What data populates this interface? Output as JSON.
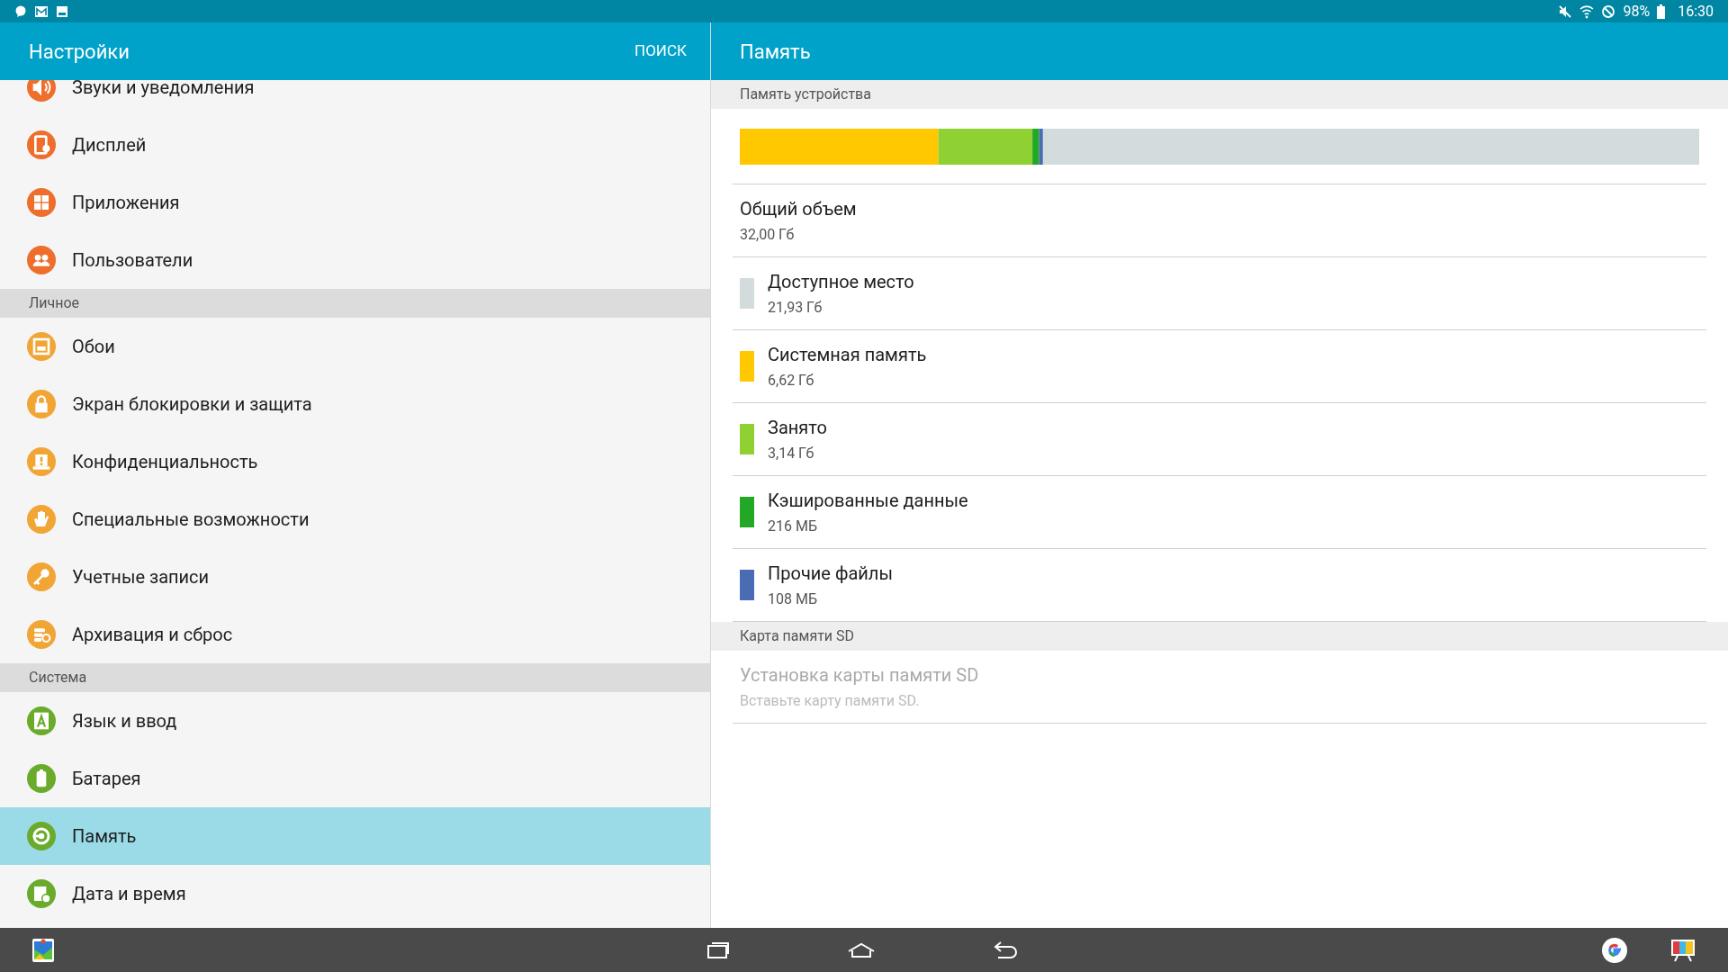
{
  "status_bar": {
    "battery": "98%",
    "time": "16:30"
  },
  "settings_panel": {
    "title": "Настройки",
    "search_button": "ПОИСК",
    "groups": [
      {
        "items": [
          {
            "label": "Звуки и уведомления",
            "color": "#ee6e2c",
            "selected": false
          },
          {
            "label": "Дисплей",
            "color": "#ee6e2c",
            "selected": false
          },
          {
            "label": "Приложения",
            "color": "#ee6e2c",
            "selected": false
          },
          {
            "label": "Пользователи",
            "color": "#ee6e2c",
            "selected": false
          }
        ]
      },
      {
        "header": "Личное",
        "items": [
          {
            "label": "Обои",
            "color": "#f0a535",
            "selected": false
          },
          {
            "label": "Экран блокировки и защита",
            "color": "#f0a535",
            "selected": false
          },
          {
            "label": "Конфиденциальность",
            "color": "#f0a535",
            "selected": false
          },
          {
            "label": "Специальные возможности",
            "color": "#f0a535",
            "selected": false
          },
          {
            "label": "Учетные записи",
            "color": "#f0a535",
            "selected": false
          },
          {
            "label": "Архивация и сброс",
            "color": "#f0a535",
            "selected": false
          }
        ]
      },
      {
        "header": "Система",
        "items": [
          {
            "label": "Язык и ввод",
            "color": "#6aab2b",
            "selected": false
          },
          {
            "label": "Батарея",
            "color": "#6aab2b",
            "selected": false
          },
          {
            "label": "Память",
            "color": "#6aab2b",
            "selected": true
          },
          {
            "label": "Дата и время",
            "color": "#6aab2b",
            "selected": false
          }
        ]
      }
    ]
  },
  "detail_panel": {
    "title": "Память",
    "device_memory": {
      "header": "Память устройства",
      "total": {
        "label": "Общий объем",
        "value": "32,00 Гб"
      },
      "categories": [
        {
          "label": "Доступное место",
          "value": "21,93 Гб",
          "color": "#d3dcdd"
        },
        {
          "label": "Системная память",
          "value": "6,62 Гб",
          "color": "#ffc800"
        },
        {
          "label": "Занято",
          "value": "3,14 Гб",
          "color": "#8fd032"
        },
        {
          "label": "Кэшированные данные",
          "value": "216 МБ",
          "color": "#22a824"
        },
        {
          "label": "Прочие файлы",
          "value": "108 МБ",
          "color": "#4a6cb5"
        }
      ]
    },
    "sd_card": {
      "header": "Карта памяти SD",
      "items": [
        {
          "title": "Установка карты памяти SD",
          "subtitle": "Вставьте карту памяти SD.",
          "disabled": true
        }
      ]
    }
  }
}
